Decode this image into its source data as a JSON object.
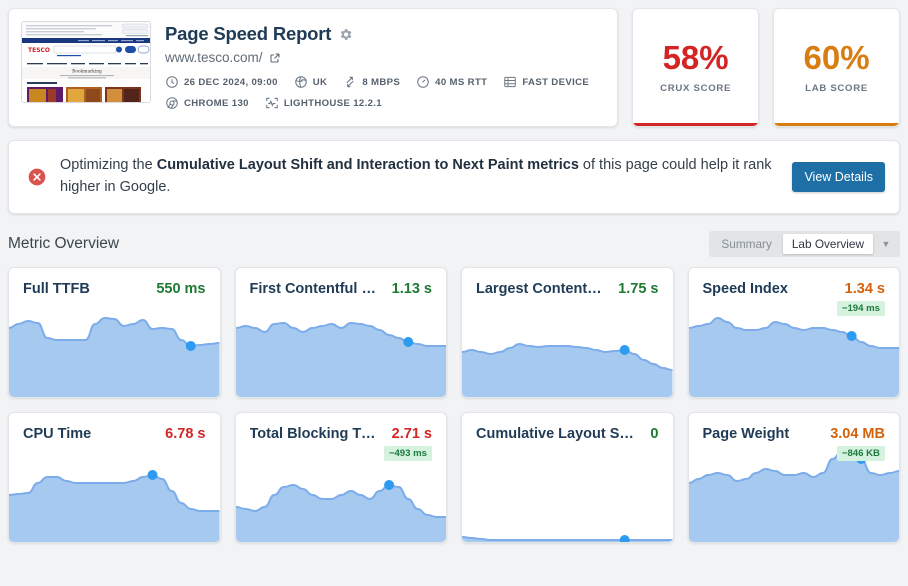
{
  "report": {
    "title": "Page Speed Report",
    "settings_icon": "gear-icon",
    "url": "www.tesco.com/",
    "external_link_icon": "external-link-icon",
    "meta_rows": [
      [
        {
          "icon": "clock-icon",
          "label": "26 DEC 2024, 09:00"
        },
        {
          "icon": "globe-icon",
          "label": "UK"
        },
        {
          "icon": "network-speed-icon",
          "label": "8 MBPS"
        },
        {
          "icon": "gauge-icon",
          "label": "40 MS RTT"
        },
        {
          "icon": "device-icon",
          "label": "FAST DEVICE"
        }
      ],
      [
        {
          "icon": "chrome-icon",
          "label": "CHROME 130"
        },
        {
          "icon": "lighthouse-icon",
          "label": "LIGHTHOUSE 12.2.1"
        }
      ]
    ]
  },
  "scores": [
    {
      "value": "58%",
      "label": "CRUX SCORE",
      "color": "#d42525"
    },
    {
      "value": "60%",
      "label": "LAB SCORE",
      "color": "#d97c12"
    }
  ],
  "banner": {
    "icon": "error-circle-icon",
    "text_before": "Optimizing the ",
    "text_bold": "Cumulative Layout Shift and Interaction to Next Paint metrics",
    "text_after": " of this page could help it rank higher in Google.",
    "button_label": "View Details"
  },
  "section": {
    "title": "Metric Overview",
    "toggle": {
      "options": [
        "Summary",
        "Lab Overview"
      ],
      "selected": "Lab Overview",
      "dropdown_icon": "chevron-down-icon"
    }
  },
  "colors": {
    "good": "#1e7a33",
    "average": "#d4620d",
    "poor": "#d42525",
    "spark_fill": "#a6c9ef",
    "spark_stroke": "#7cacea",
    "dot": "#2d9cf0"
  },
  "metrics": [
    {
      "name": "Full TTFB",
      "value": "550 ms",
      "status": "good",
      "badge": null,
      "points": [
        62,
        58,
        55,
        57,
        72,
        74,
        74,
        74,
        74,
        58,
        52,
        53,
        60,
        58,
        54,
        63,
        62,
        63,
        74,
        80,
        79,
        78,
        77
      ],
      "dot_index": 19
    },
    {
      "name": "First Contentful …",
      "value": "1.13 s",
      "status": "good",
      "badge": null,
      "points": [
        62,
        60,
        62,
        66,
        58,
        57,
        62,
        66,
        62,
        60,
        58,
        62,
        57,
        58,
        60,
        64,
        69,
        72,
        76,
        78,
        80,
        80,
        80
      ],
      "dot_index": 18
    },
    {
      "name": "Largest Content…",
      "value": "1.75 s",
      "status": "good",
      "badge": null,
      "points": [
        86,
        84,
        86,
        88,
        86,
        82,
        78,
        80,
        81,
        80,
        80,
        80,
        81,
        82,
        84,
        86,
        85,
        84,
        88,
        94,
        98,
        102,
        104
      ],
      "dot_index": 17
    },
    {
      "name": "Speed Index",
      "value": "1.34 s",
      "status": "average",
      "badge": "−194 ms",
      "points": [
        62,
        60,
        58,
        52,
        56,
        62,
        64,
        64,
        62,
        56,
        58,
        62,
        64,
        62,
        62,
        64,
        66,
        70,
        76,
        80,
        82,
        82,
        82
      ],
      "dot_index": 17
    },
    {
      "name": "CPU Time",
      "value": "6.78 s",
      "status": "poor",
      "badge": null,
      "points": [
        84,
        83,
        82,
        72,
        66,
        66,
        70,
        72,
        72,
        72,
        72,
        72,
        72,
        70,
        66,
        64,
        68,
        80,
        92,
        98,
        100,
        100,
        100
      ],
      "dot_index": 15
    },
    {
      "name": "Total Blocking Ti…",
      "value": "2.71 s",
      "status": "poor",
      "badge": "−493 ms",
      "points": [
        96,
        98,
        100,
        96,
        84,
        76,
        74,
        78,
        84,
        88,
        88,
        84,
        80,
        84,
        88,
        80,
        74,
        76,
        88,
        98,
        104,
        106,
        106
      ],
      "dot_index": 16
    },
    {
      "name": "Cumulative Layout S…",
      "value": "0",
      "status": "good",
      "badge": null,
      "points": [
        126,
        127,
        128,
        129,
        129,
        129,
        129,
        129,
        129,
        129,
        129,
        129,
        129,
        129,
        129,
        129,
        129,
        129,
        129,
        129,
        129,
        129,
        129
      ],
      "dot_index": 17
    },
    {
      "name": "Page Weight",
      "value": "3.04 MB",
      "status": "average",
      "badge": "−846 KB",
      "points": [
        72,
        68,
        64,
        62,
        64,
        70,
        68,
        62,
        58,
        60,
        64,
        64,
        62,
        66,
        62,
        48,
        40,
        42,
        48,
        62,
        64,
        62,
        60
      ],
      "dot_index": 18
    }
  ]
}
